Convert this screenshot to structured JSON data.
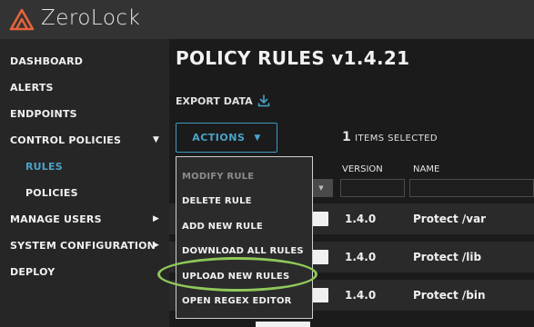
{
  "app": {
    "brand": "ZeroLock"
  },
  "sidebar": {
    "items": [
      {
        "label": "DASHBOARD"
      },
      {
        "label": "ALERTS"
      },
      {
        "label": "ENDPOINTS"
      },
      {
        "label": "CONTROL POLICIES",
        "arrow": "▼"
      },
      {
        "label": "RULES"
      },
      {
        "label": "POLICIES"
      },
      {
        "label": "MANAGE USERS",
        "arrow": "▶"
      },
      {
        "label": "SYSTEM CONFIGURATION",
        "arrow": "▶"
      },
      {
        "label": "DEPLOY"
      }
    ]
  },
  "main": {
    "title": "POLICY RULES v1.4.21",
    "export_label": "EXPORT DATA",
    "actions_label": "ACTIONS",
    "actions_caret": "▼",
    "selected_count": "1",
    "selected_label": "ITEMS SELECTED",
    "columns": {
      "version": "VERSION",
      "name": "NAME"
    },
    "filter_caret": "▼",
    "rows": [
      {
        "version": "1.4.0",
        "name": "Protect /var"
      },
      {
        "version": "1.4.0",
        "name": "Protect /lib"
      },
      {
        "version": "1.4.0",
        "name": "Protect /bin"
      }
    ]
  },
  "actions_menu": {
    "items": [
      {
        "label": "MODIFY RULE",
        "disabled": true
      },
      {
        "label": "DELETE RULE"
      },
      {
        "label": "ADD NEW RULE"
      },
      {
        "label": "DOWNLOAD ALL RULES"
      },
      {
        "label": "UPLOAD NEW RULES"
      },
      {
        "label": "OPEN REGEX EDITOR"
      }
    ]
  },
  "colors": {
    "accent": "#4aa3c9",
    "logo": "#e8633a",
    "highlight": "#8fc95a"
  },
  "icons": {
    "logo": "zerolock-logo-icon",
    "download": "download-icon"
  }
}
